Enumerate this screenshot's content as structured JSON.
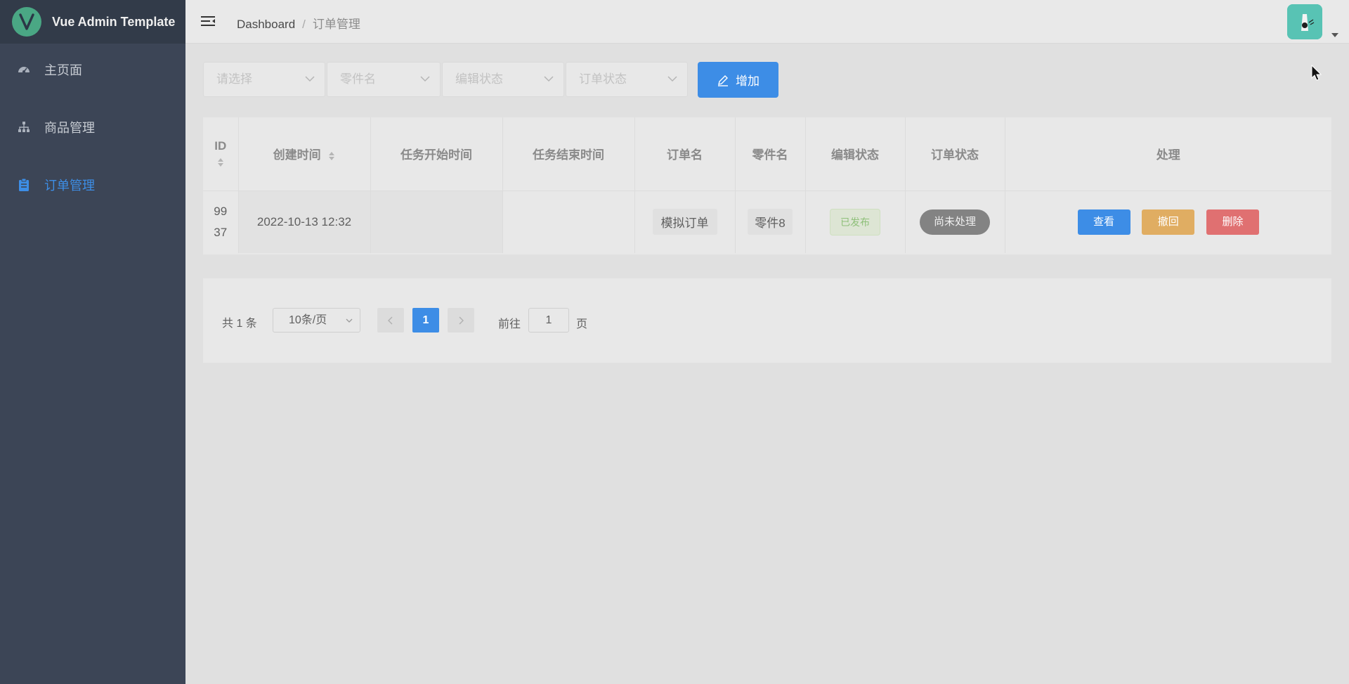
{
  "app": {
    "title": "Vue Admin Template",
    "accent_color": "#3d8de6",
    "sidebar_bg": "#3c4556"
  },
  "sidebar": {
    "items": [
      {
        "label": "主页面",
        "icon": "dashboard-icon",
        "active": false
      },
      {
        "label": "商品管理",
        "icon": "tree-icon",
        "active": false
      },
      {
        "label": "订单管理",
        "icon": "clipboard-icon",
        "active": true
      }
    ]
  },
  "header": {
    "breadcrumb": {
      "root": "Dashboard",
      "separator": "/",
      "current": "订单管理"
    },
    "avatar_icon": "user-avatar-icon"
  },
  "filters": {
    "select1_placeholder": "请选择",
    "part_placeholder": "零件名",
    "edit_status_placeholder": "编辑状态",
    "order_status_placeholder": "订单状态",
    "add_button_label": "增加"
  },
  "table": {
    "columns": {
      "id": "ID",
      "created": "创建时间",
      "task_start": "任务开始时间",
      "task_end": "任务结束时间",
      "order_name": "订单名",
      "part_name": "零件名",
      "edit_status": "编辑状态",
      "order_status": "订单状态",
      "actions": "处理"
    },
    "rows": [
      {
        "id_line1": "99",
        "id_line2": "37",
        "created": "2022-10-13 12:32",
        "task_start": "",
        "task_end": "",
        "order_name": "模拟订单",
        "part_name": "零件8",
        "edit_status": "已发布",
        "order_status": "尚未处理",
        "view": "查看",
        "revoke": "撤回",
        "delete": "删除"
      }
    ]
  },
  "pagination": {
    "total_text": "共 1 条",
    "page_size": "10条/页",
    "current_page": "1",
    "goto_label": "前往",
    "goto_value": "1",
    "goto_suffix": "页"
  }
}
